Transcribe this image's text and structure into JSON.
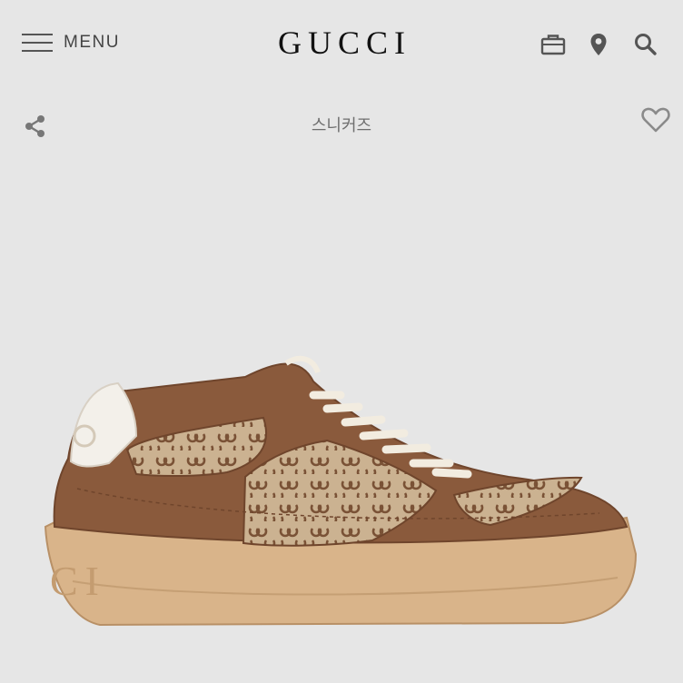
{
  "header": {
    "menu_label": "MENU",
    "logo": "GUCCI",
    "icons": [
      "hamburger-menu-icon",
      "shopping-bag-icon",
      "location-pin-icon",
      "search-icon"
    ]
  },
  "product": {
    "category": "스니커즈",
    "image_alt": "sneaker",
    "colors": {
      "leather": "#8a5a3c",
      "canvas": "#c9b08e",
      "gg_pattern": "#7a5236",
      "sole": "#d9b48a",
      "heel_tab": "#f3f0ea",
      "laces": "#f2ece0"
    }
  },
  "actions": {
    "share_icon": "share-icon",
    "wishlist_icon": "heart-outline-icon"
  },
  "theme": {
    "background": "#e6e6e6",
    "icon_color": "#555555"
  }
}
